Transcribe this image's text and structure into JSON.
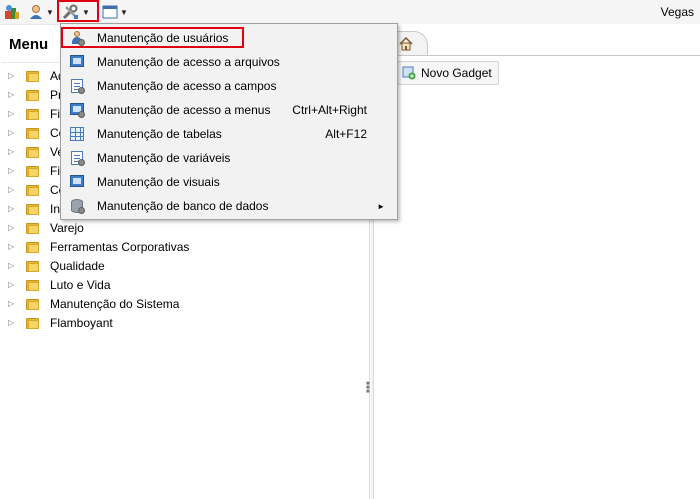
{
  "toolbar": {
    "user_name": "Vegas"
  },
  "left_panel": {
    "title": "Menu",
    "tree_items": [
      {
        "label": "Ad"
      },
      {
        "label": "Pro"
      },
      {
        "label": "Fin"
      },
      {
        "label": "Co"
      },
      {
        "label": "Ve"
      },
      {
        "label": "Fis"
      },
      {
        "label": "Co"
      },
      {
        "label": "Ind"
      },
      {
        "label": "Varejo"
      },
      {
        "label": "Ferramentas Corporativas"
      },
      {
        "label": "Qualidade"
      },
      {
        "label": "Luto e Vida"
      },
      {
        "label": "Manutenção do Sistema"
      },
      {
        "label": "Flamboyant"
      }
    ]
  },
  "right_panel": {
    "new_gadget_label": "Novo Gadget"
  },
  "dropdown": {
    "items": [
      {
        "label": "Manutenção de usuários",
        "shortcut": "",
        "icon": "user-gear-icon"
      },
      {
        "label": "Manutenção de acesso a arquivos",
        "shortcut": "",
        "icon": "screen-icon"
      },
      {
        "label": "Manutenção de acesso a campos",
        "shortcut": "",
        "icon": "document-icon"
      },
      {
        "label": "Manutenção de acesso a menus",
        "shortcut": "Ctrl+Alt+Right",
        "icon": "menu-icon"
      },
      {
        "label": "Manutenção de tabelas",
        "shortcut": "Alt+F12",
        "icon": "table-icon"
      },
      {
        "label": "Manutenção de variáveis",
        "shortcut": "",
        "icon": "document-icon"
      },
      {
        "label": "Manutenção de visuais",
        "shortcut": "",
        "icon": "screen-icon"
      },
      {
        "label": "Manutenção de banco de dados",
        "shortcut": "",
        "icon": "database-icon",
        "has_submenu": true
      }
    ]
  },
  "colors": {
    "highlight": "#e00010",
    "folder": "#f7d468",
    "accent_blue": "#3d7dcb"
  }
}
